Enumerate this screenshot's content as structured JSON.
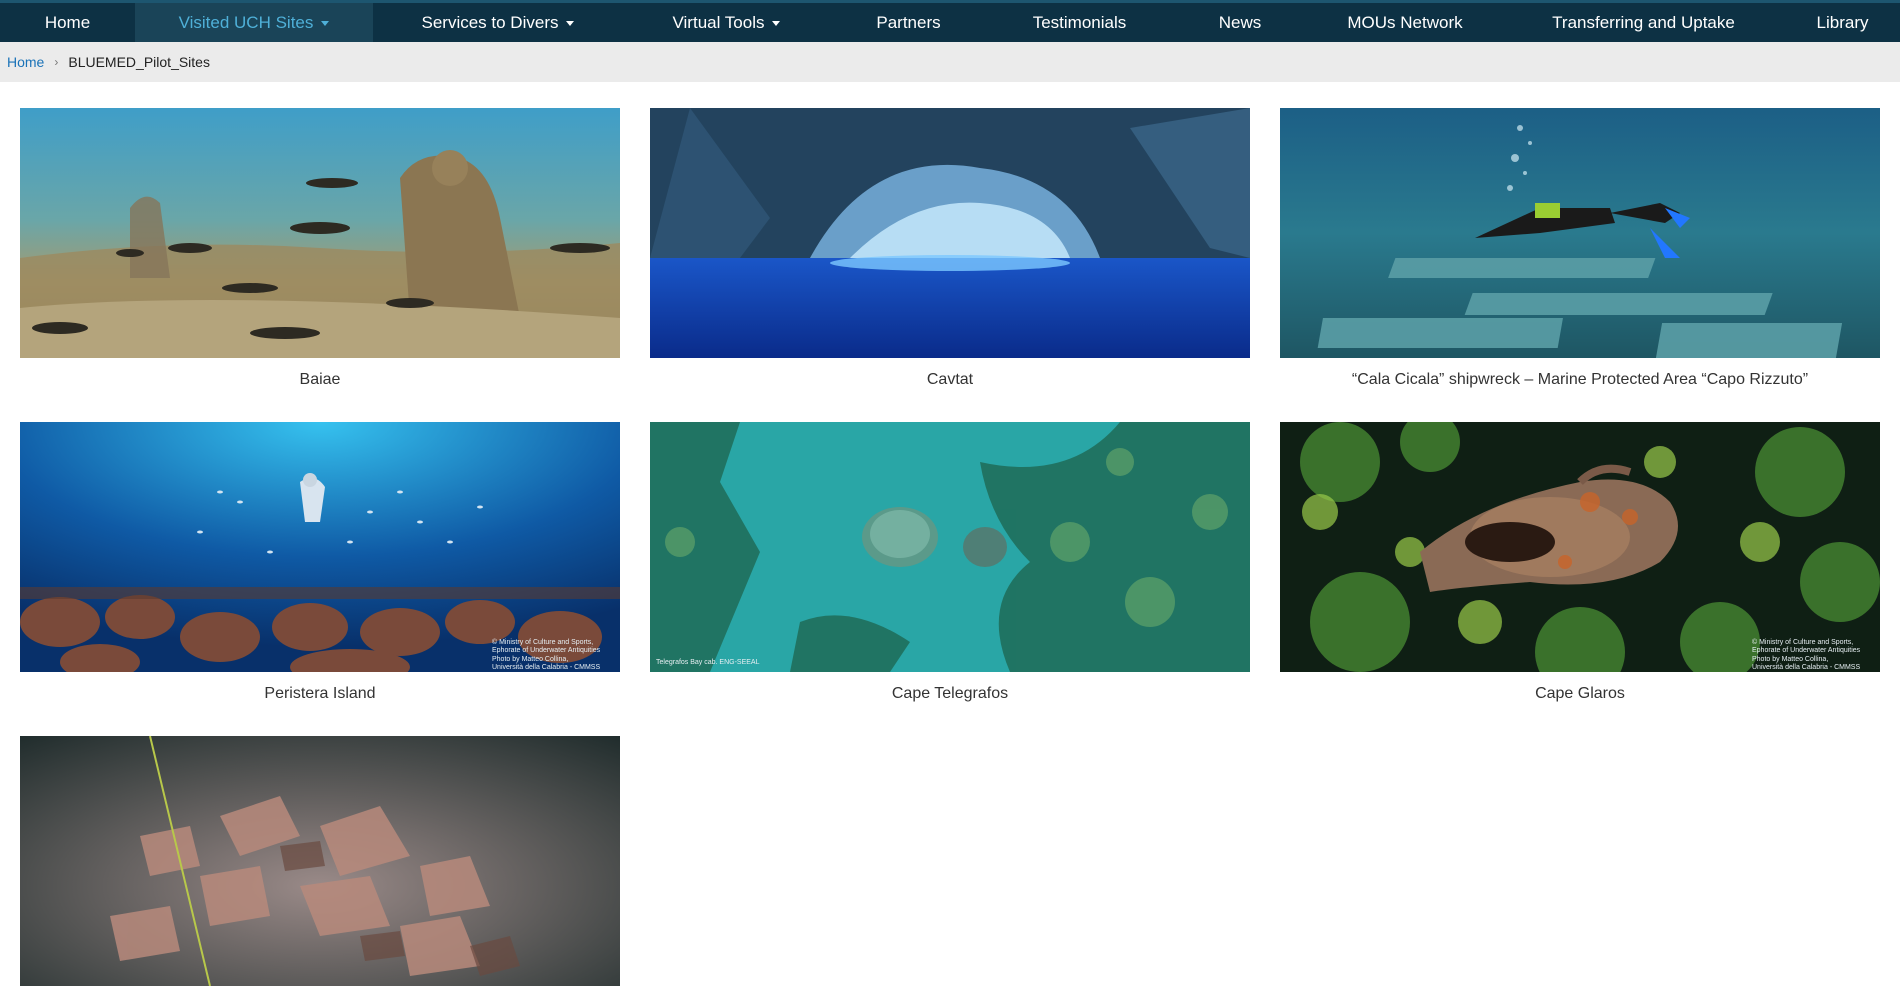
{
  "nav": {
    "items": [
      {
        "label": "Home"
      },
      {
        "label": "Visited UCH Sites"
      },
      {
        "label": "Services to Divers"
      },
      {
        "label": "Virtual Tools"
      },
      {
        "label": "Partners"
      },
      {
        "label": "Testimonials"
      },
      {
        "label": "News"
      },
      {
        "label": "MOUs Network"
      },
      {
        "label": "Transferring and Uptake"
      },
      {
        "label": "Library"
      }
    ],
    "active_index": 1
  },
  "breadcrumb": {
    "home": "Home",
    "separator": "›",
    "current": "BLUEMED_Pilot_Sites"
  },
  "sites": [
    {
      "caption": "Baiae",
      "icon": "underwater-statues-photo"
    },
    {
      "caption": "Cavtat",
      "icon": "sea-cave-photo"
    },
    {
      "caption": "“Cala Cicala” shipwreck – Marine Protected Area “Capo Rizzuto”",
      "icon": "diver-over-stone-blocks-photo"
    },
    {
      "caption": "Peristera Island",
      "icon": "diver-over-amphorae-photo",
      "credit_1": "© Ministry of Culture and Sports,",
      "credit_2": "Ephorate of Underwater Antiquities",
      "credit_3": "Photo by Matteo Collina,",
      "credit_4": "Università della Calabria - CMMSS"
    },
    {
      "caption": "Cape Telegrafos",
      "icon": "seagrass-seabed-photo",
      "credit_1": "Telegrafos Bay cab. ENG-SEEAL"
    },
    {
      "caption": "Cape Glaros",
      "icon": "amphora-in-seaweed-photo",
      "credit_1": "© Ministry of Culture and Sports,",
      "credit_2": "Ephorate of Underwater Antiquities",
      "credit_3": "Photo by Matteo Collina,",
      "credit_4": "Università della Calabria - CMMSS"
    },
    {
      "caption": "",
      "icon": "pottery-shards-seabed-photo"
    }
  ],
  "colors": {
    "nav_bg": "#0d3144",
    "nav_active_bg": "#1a4458",
    "nav_active_text": "#4fb0d8",
    "breadcrumb_bg": "#ebebeb",
    "link": "#1b73b8"
  }
}
